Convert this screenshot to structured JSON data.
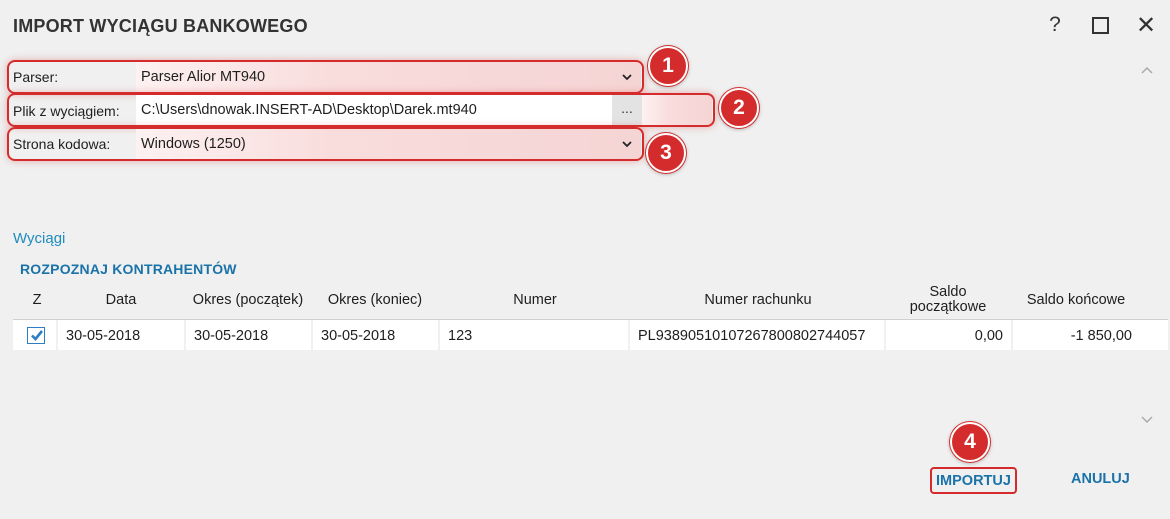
{
  "window": {
    "title": "IMPORT WYCIĄGU BANKOWEGO",
    "help_glyph": "?",
    "close_glyph": "✕"
  },
  "form": {
    "parser": {
      "label": "Parser:",
      "value": "Parser Alior MT940",
      "badge": "1"
    },
    "file": {
      "label": "Plik z wyciągiem:",
      "value": "C:\\Users\\dnowak.INSERT-AD\\Desktop\\Darek.mt940",
      "browse_label": "...",
      "badge": "2"
    },
    "codepage": {
      "label": "Strona kodowa:",
      "value": "Windows (1250)",
      "badge": "3"
    }
  },
  "statements": {
    "section_title": "Wyciągi",
    "recognize_link": "ROZPOZNAJ KONTRAHENTÓW",
    "columns": {
      "z": "Z",
      "date": "Data",
      "period_start": "Okres (początek)",
      "period_end": "Okres (koniec)",
      "number": "Numer",
      "account": "Numer rachunku",
      "opening_1": "Saldo",
      "opening_2": "początkowe",
      "closing": "Saldo końcowe"
    },
    "rows": [
      {
        "checked": true,
        "date": "30-05-2018",
        "period_start": "30-05-2018",
        "period_end": "30-05-2018",
        "number": "123",
        "account": "PL93890510107267800802744057",
        "opening_balance": "0,00",
        "closing_balance": "-1 850,00"
      }
    ]
  },
  "footer": {
    "import_label": "IMPORTUJ",
    "import_badge": "4",
    "cancel_label": "ANULUJ"
  },
  "colors": {
    "highlight": "#d42c2c",
    "accent_link": "#1a73a8",
    "section": "#1f8bbf",
    "checkbox": "#2e7bc6"
  }
}
